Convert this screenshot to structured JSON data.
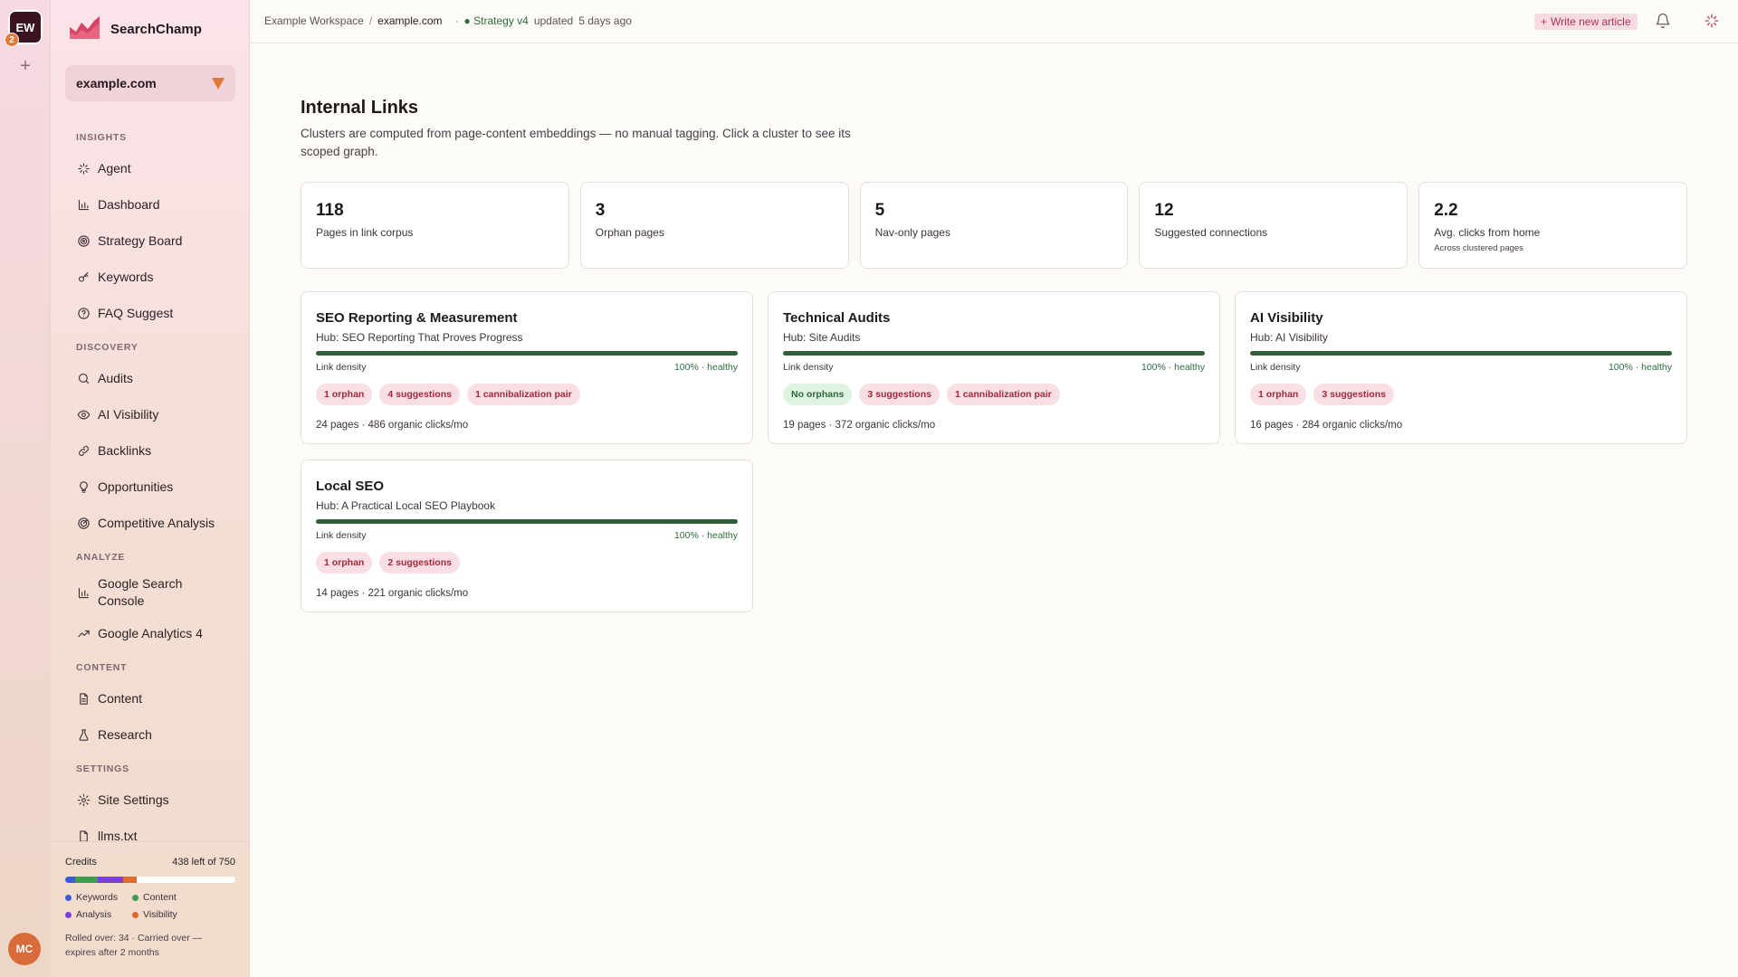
{
  "workspace": {
    "initials": "EW",
    "count": "2",
    "add_symbol": "+"
  },
  "user": {
    "initials": "MC"
  },
  "brand": {
    "name": "SearchChamp"
  },
  "site_selector": {
    "value": "example.com"
  },
  "nav": {
    "sections": [
      {
        "title": "INSIGHTS",
        "items": [
          {
            "label": "Agent",
            "icon": "sparkle-icon"
          },
          {
            "label": "Dashboard",
            "icon": "bar-chart-icon"
          },
          {
            "label": "Strategy Board",
            "icon": "target-icon"
          },
          {
            "label": "Keywords",
            "icon": "key-icon"
          },
          {
            "label": "FAQ Suggest",
            "icon": "help-circle-icon"
          }
        ]
      },
      {
        "title": "DISCOVERY",
        "items": [
          {
            "label": "Audits",
            "icon": "search-icon"
          },
          {
            "label": "AI Visibility",
            "icon": "eye-icon"
          },
          {
            "label": "Backlinks",
            "icon": "link-icon"
          },
          {
            "label": "Opportunities",
            "icon": "lightbulb-icon"
          },
          {
            "label": "Competitive Analysis",
            "icon": "radar-icon"
          }
        ]
      },
      {
        "title": "ANALYZE",
        "items": [
          {
            "label": "Google Search Console",
            "icon": "bar-chart-icon"
          },
          {
            "label": "Google Analytics 4",
            "icon": "trend-icon"
          }
        ]
      },
      {
        "title": "CONTENT",
        "items": [
          {
            "label": "Content",
            "icon": "document-icon"
          },
          {
            "label": "Research",
            "icon": "flask-icon"
          }
        ]
      },
      {
        "title": "SETTINGS",
        "items": [
          {
            "label": "Site Settings",
            "icon": "gear-icon"
          },
          {
            "label": "llms.txt",
            "icon": "file-icon"
          }
        ]
      }
    ]
  },
  "credits": {
    "label": "Credits",
    "remaining": "438 left of 750",
    "segments": [
      {
        "name": "Keywords",
        "color": "#3b5bdb",
        "fraction": 0.06
      },
      {
        "name": "Content",
        "color": "#3f9d4e",
        "fraction": 0.13
      },
      {
        "name": "Analysis",
        "color": "#7a3fd6",
        "fraction": 0.15
      },
      {
        "name": "Visibility",
        "color": "#e06a2c",
        "fraction": 0.08
      }
    ],
    "legend": [
      "Keywords",
      "Content",
      "Analysis",
      "Visibility"
    ],
    "rollover": "Rolled over: 34 · Carried over — expires after 2 months"
  },
  "topbar": {
    "workspace": "Example Workspace",
    "separator": "/",
    "site": "example.com",
    "dot": "·",
    "strategy": "● Strategy v4",
    "updated_label": "updated",
    "updated_value": "5 days ago",
    "write_button": "Write new article"
  },
  "page": {
    "title": "Internal Links",
    "subtitle": "Clusters are computed from page-content embeddings — no manual tagging. Click a cluster to see its scoped graph."
  },
  "stats": [
    {
      "value": "118",
      "label": "Pages in link corpus",
      "note": ""
    },
    {
      "value": "3",
      "label": "Orphan pages",
      "note": ""
    },
    {
      "value": "5",
      "label": "Nav-only pages",
      "note": ""
    },
    {
      "value": "12",
      "label": "Suggested connections",
      "note": ""
    },
    {
      "value": "2.2",
      "label": "Avg. clicks from home",
      "note": "Across clustered pages"
    }
  ],
  "clusters": [
    {
      "title": "SEO Reporting & Measurement",
      "hub": "Hub: SEO Reporting That Proves Progress",
      "density_label": "Link density",
      "density_fraction": 1.0,
      "density_text": "100% · healthy",
      "pills": [
        {
          "text": "1 orphan",
          "tone": "red"
        },
        {
          "text": "4 suggestions",
          "tone": "red"
        },
        {
          "text": "1 cannibalization pair",
          "tone": "red"
        }
      ],
      "footer": "24 pages · 486 organic clicks/mo"
    },
    {
      "title": "Technical Audits",
      "hub": "Hub: Site Audits",
      "density_label": "Link density",
      "density_fraction": 1.0,
      "density_text": "100% · healthy",
      "pills": [
        {
          "text": "No orphans",
          "tone": "green"
        },
        {
          "text": "3 suggestions",
          "tone": "red"
        },
        {
          "text": "1 cannibalization pair",
          "tone": "red"
        }
      ],
      "footer": "19 pages · 372 organic clicks/mo"
    },
    {
      "title": "AI Visibility",
      "hub": "Hub: AI Visibility",
      "density_label": "Link density",
      "density_fraction": 1.0,
      "density_text": "100% · healthy",
      "pills": [
        {
          "text": "1 orphan",
          "tone": "red"
        },
        {
          "text": "3 suggestions",
          "tone": "red"
        }
      ],
      "footer": "16 pages · 284 organic clicks/mo"
    },
    {
      "title": "Local SEO",
      "hub": "Hub: A Practical Local SEO Playbook",
      "density_label": "Link density",
      "density_fraction": 1.0,
      "density_text": "100% · healthy",
      "pills": [
        {
          "text": "1 orphan",
          "tone": "red"
        },
        {
          "text": "2 suggestions",
          "tone": "red"
        }
      ],
      "footer": "14 pages · 221 organic clicks/mo"
    }
  ]
}
